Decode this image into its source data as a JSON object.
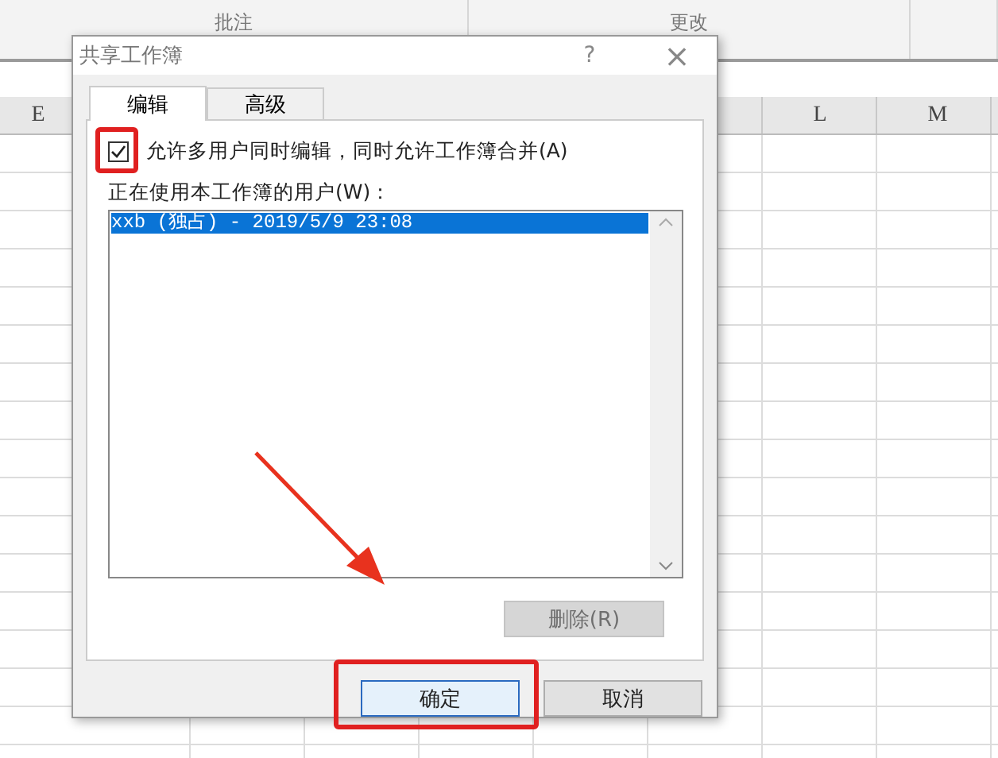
{
  "ribbon": {
    "groups": [
      {
        "label": "批注"
      },
      {
        "label": "更改"
      }
    ]
  },
  "sheet": {
    "column_headers": [
      {
        "label": "E"
      },
      {
        "label": "L"
      },
      {
        "label": "M"
      }
    ]
  },
  "dialog": {
    "title": "共享工作簿",
    "help": "?",
    "close": "×",
    "tabs": [
      {
        "label": "编辑",
        "selected": true
      },
      {
        "label": "高级",
        "selected": false
      }
    ],
    "allow_edit": {
      "label": "允许多用户同时编辑，同时允许工作簿合并(A)",
      "checked": true,
      "highlighted": true
    },
    "users_label": "正在使用本工作簿的用户(W)：",
    "users": [
      {
        "text": "xxb (独占) - 2019/5/9 23:08",
        "selected": true
      }
    ],
    "remove_button": {
      "label": "删除(R)",
      "disabled": true
    },
    "buttons": [
      {
        "label": "确定",
        "kind": "default",
        "highlighted": true
      },
      {
        "label": "取消",
        "kind": "normal",
        "highlighted": false
      }
    ],
    "pointer_arrow": true
  }
}
